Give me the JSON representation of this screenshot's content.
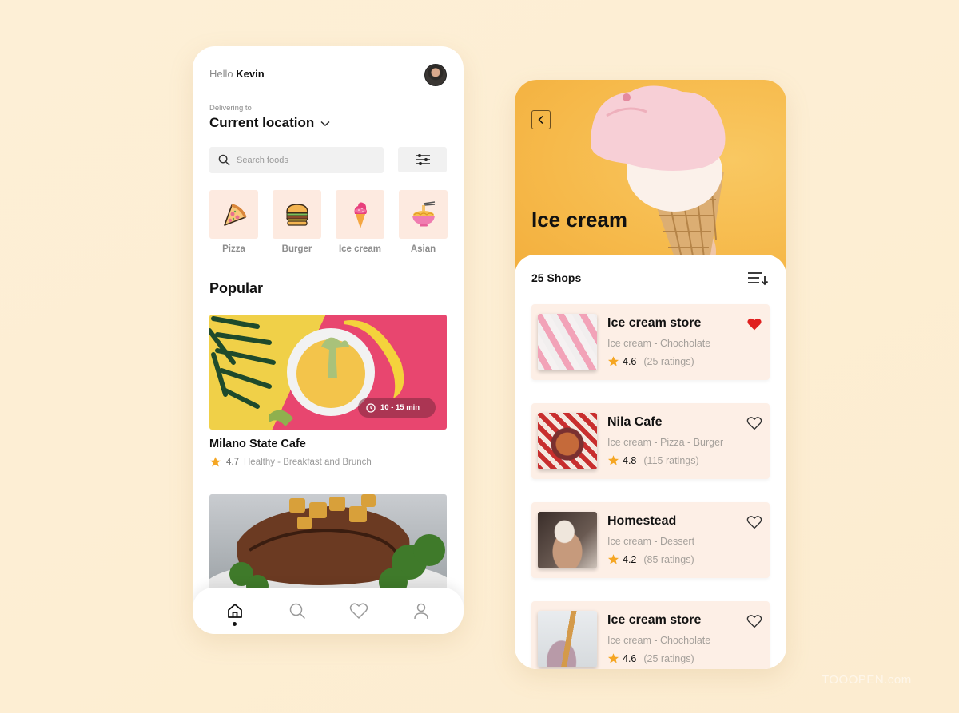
{
  "home": {
    "greeting_prefix": "Hello",
    "user_name": "Kevin",
    "delivering_label": "Delivering to",
    "location": "Current location",
    "search_placeholder": "Search foods",
    "categories": [
      {
        "label": "Pizza",
        "icon": "pizza-icon"
      },
      {
        "label": "Burger",
        "icon": "burger-icon"
      },
      {
        "label": "Ice cream",
        "icon": "ice-cream-icon"
      },
      {
        "label": "Asian",
        "icon": "noodle-bowl-icon"
      }
    ],
    "popular_heading": "Popular",
    "featured": {
      "delivery_time": "10 - 15 min",
      "title": "Milano State Cafe",
      "rating": "4.7",
      "tags": "Healthy - Breakfast and Brunch"
    },
    "bottom_nav": [
      {
        "name": "home",
        "icon": "home-icon",
        "active": true
      },
      {
        "name": "search",
        "icon": "search-icon",
        "active": false
      },
      {
        "name": "favorites",
        "icon": "heart-icon",
        "active": false
      },
      {
        "name": "profile",
        "icon": "user-icon",
        "active": false
      }
    ]
  },
  "category_page": {
    "title": "Ice cream",
    "shops_count": "25 Shops",
    "shops": [
      {
        "name": "Ice cream store",
        "tags": "Ice cream - Chocholate",
        "rating": "4.6",
        "ratings_count": "(25 ratings)",
        "favorite": true
      },
      {
        "name": "Nila Cafe",
        "tags": "Ice cream - Pizza - Burger",
        "rating": "4.8",
        "ratings_count": "(115 ratings)",
        "favorite": false
      },
      {
        "name": "Homestead",
        "tags": "Ice cream - Dessert",
        "rating": "4.2",
        "ratings_count": "(85 ratings)",
        "favorite": false
      },
      {
        "name": "Ice cream store",
        "tags": "Ice cream - Chocholate",
        "rating": "4.6",
        "ratings_count": "(25 ratings)",
        "favorite": false
      }
    ]
  },
  "colors": {
    "background": "#fdefd5",
    "category_tile": "#fdeae0",
    "shop_card": "#fdefe6",
    "star": "#f5a623",
    "favorite_active": "#e0201f",
    "hero_yellow": "#f6b94a"
  },
  "watermark": "TOOOPEN.com"
}
